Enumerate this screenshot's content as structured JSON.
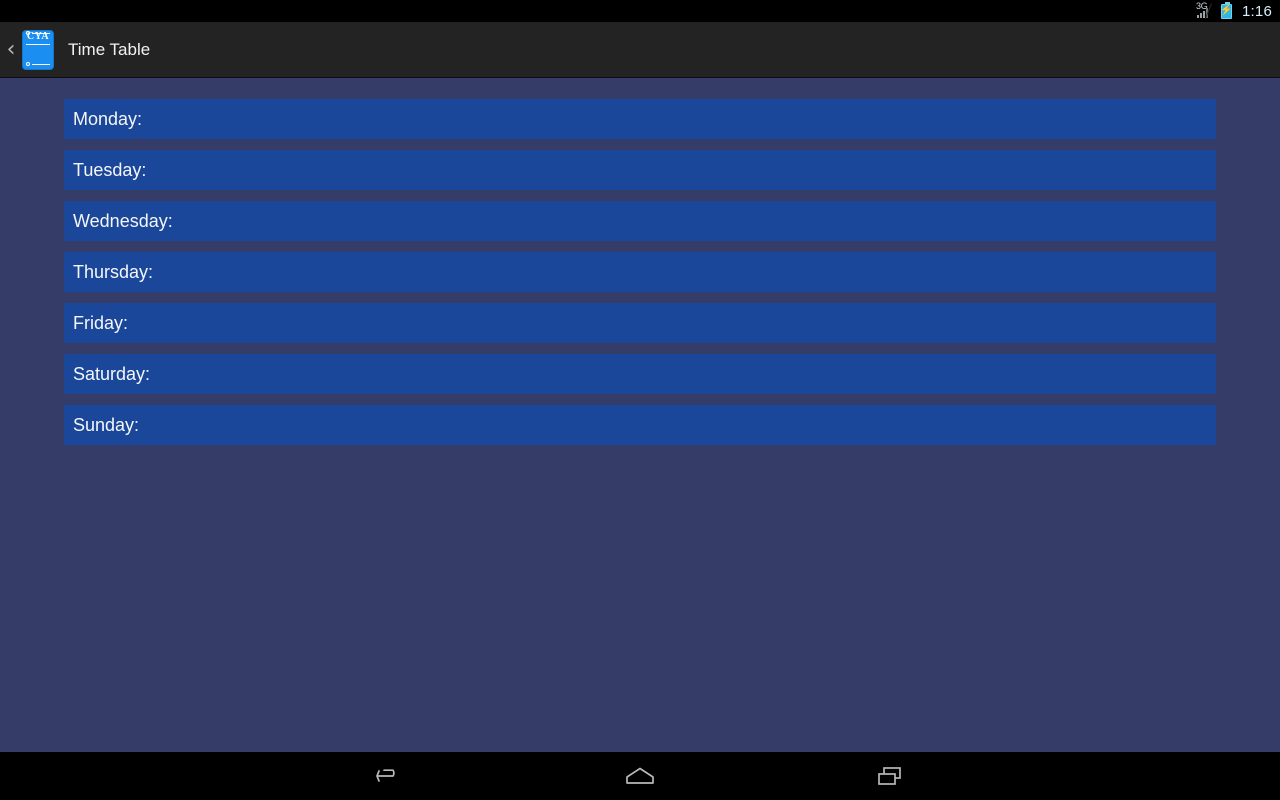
{
  "status_bar": {
    "network_label": "3G",
    "signal_icon": "signal-bars-icon",
    "battery_icon": "battery-charging-icon",
    "battery_bolt": "⚡",
    "clock": "1:16"
  },
  "action_bar": {
    "up_chevron": "‹",
    "app_icon": {
      "name": "time-table-app-icon",
      "badge_text": "CYA"
    },
    "title": "Time Table"
  },
  "content": {
    "days": [
      {
        "label": "Monday:"
      },
      {
        "label": "Tuesday:"
      },
      {
        "label": "Wednesday:"
      },
      {
        "label": "Thursday:"
      },
      {
        "label": "Friday:"
      },
      {
        "label": "Saturday:"
      },
      {
        "label": "Sunday:"
      }
    ]
  },
  "nav_bar": {
    "back_label": "Back",
    "home_label": "Home",
    "recents_label": "Recent apps"
  },
  "colors": {
    "status_bar_bg": "#000000",
    "action_bar_bg": "#232323",
    "page_bg": "#353c68",
    "row_bg": "#1a4799",
    "row_text": "#f4f6f8",
    "clock_text": "#d7eef7",
    "icon_blue": "#1b8ef2"
  }
}
